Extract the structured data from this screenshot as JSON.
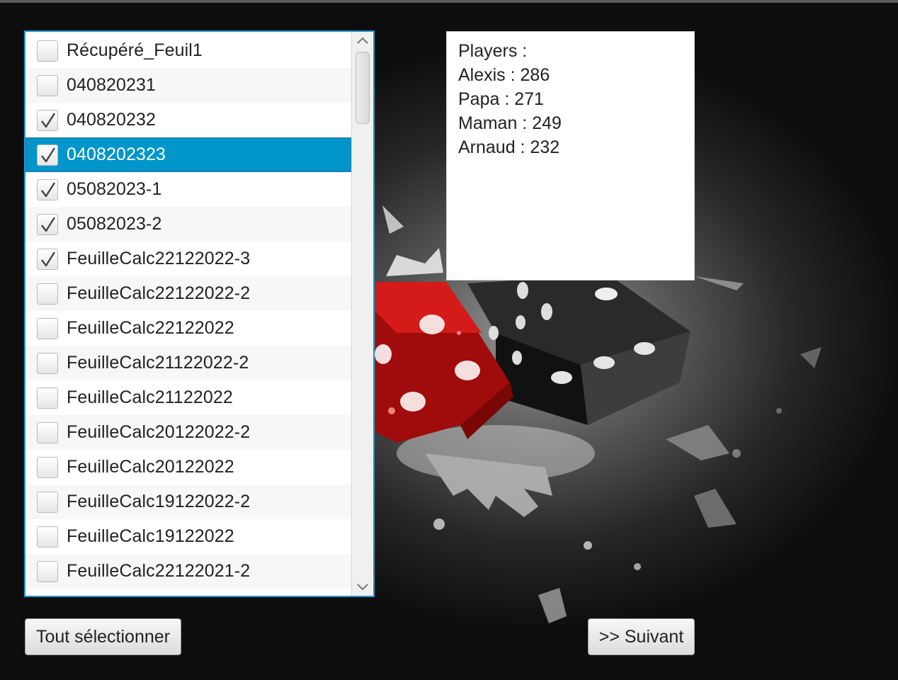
{
  "sheet_list": {
    "items": [
      {
        "label": "Récupéré_Feuil1",
        "checked": false
      },
      {
        "label": "040820231",
        "checked": false
      },
      {
        "label": "040820232",
        "checked": true
      },
      {
        "label": "0408202323",
        "checked": true,
        "selected": true
      },
      {
        "label": "05082023-1",
        "checked": true
      },
      {
        "label": "05082023-2",
        "checked": true
      },
      {
        "label": "FeuilleCalc22122022-3",
        "checked": true
      },
      {
        "label": "FeuilleCalc22122022-2",
        "checked": false
      },
      {
        "label": "FeuilleCalc22122022",
        "checked": false
      },
      {
        "label": "FeuilleCalc21122022-2",
        "checked": false
      },
      {
        "label": "FeuilleCalc21122022",
        "checked": false
      },
      {
        "label": "FeuilleCalc20122022-2",
        "checked": false
      },
      {
        "label": "FeuilleCalc20122022",
        "checked": false
      },
      {
        "label": "FeuilleCalc19122022-2",
        "checked": false
      },
      {
        "label": "FeuilleCalc19122022",
        "checked": false
      },
      {
        "label": "FeuilleCalc22122021-2",
        "checked": false
      },
      {
        "label": "",
        "checked": false
      }
    ]
  },
  "players": {
    "title": "Players :",
    "lines": [
      "Alexis : 286",
      "Papa : 271",
      "Maman : 249",
      "Arnaud : 232"
    ]
  },
  "buttons": {
    "select_all": "Tout sélectionner",
    "next": ">> Suivant"
  },
  "colors": {
    "selection": "#0096c9",
    "border_focus": "#1b9bd1"
  },
  "icons": {
    "checkmark": "checkmark-icon",
    "scroll_up": "chevron-up-icon",
    "scroll_down": "chevron-down-icon"
  }
}
